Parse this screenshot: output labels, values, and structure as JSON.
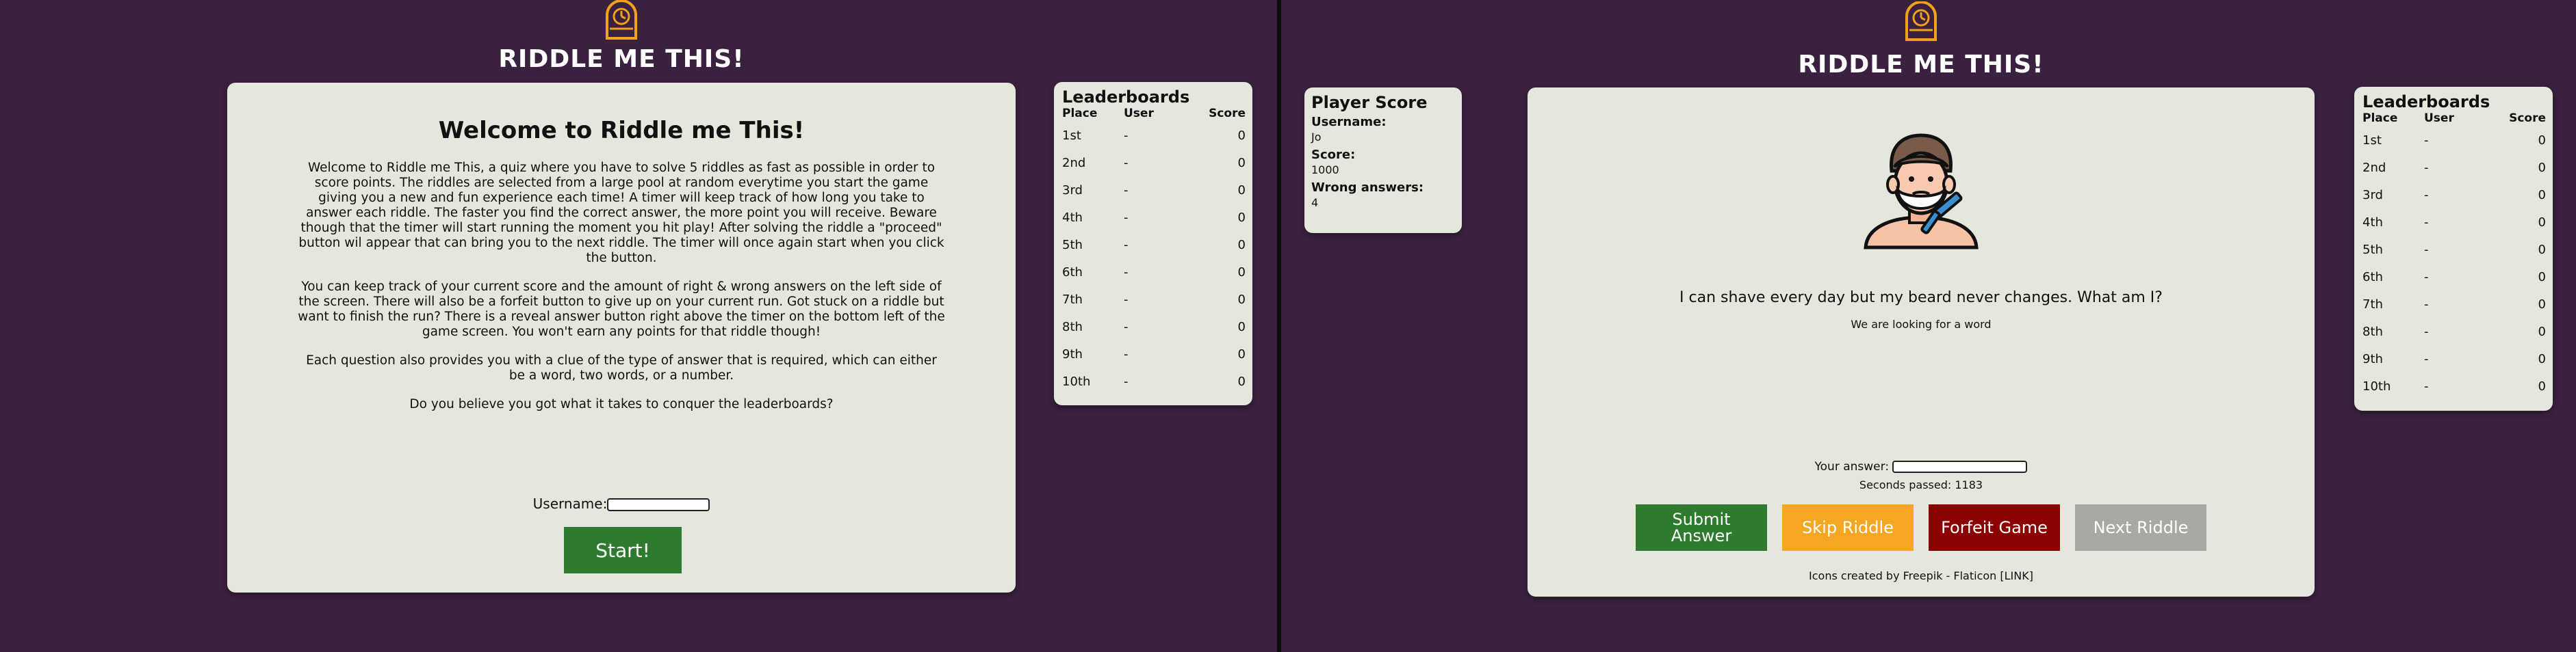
{
  "site": {
    "title": "RIDDLE ME THIS!"
  },
  "left_screen": {
    "welcome": {
      "heading": "Welcome to Riddle me This!",
      "paragraphs": [
        "Welcome to Riddle me This, a quiz where you have to solve 5 riddles as fast as possible in order to score points. The riddles are selected from a large pool at random everytime you start the game giving you a new and fun experience each time! A timer will keep track of how long you take to answer each riddle. The faster you find the correct answer, the more point you will receive. Beware though that the timer will start running the moment you hit play! After solving the riddle a \"proceed\" button wil appear that can bring you to the next riddle. The timer will once again start when you click the button.",
        "You can keep track of your current score and the amount of right & wrong answers on the left side of the screen. There will also be a forfeit button to give up on your current run. Got stuck on a riddle but want to finish the run? There is a reveal answer button right above the timer on the bottom left of the game screen. You won't earn any points for that riddle though!",
        "Each question also provides you with a clue of the type of answer that is required, which can either be a word, two words, or a number.",
        "Do you believe you got what it takes to conquer the leaderboards?"
      ],
      "username_label": "Username:",
      "username_value": "",
      "start_label": "Start!"
    }
  },
  "leaderboard": {
    "title": "Leaderboards",
    "headers": {
      "place": "Place",
      "user": "User",
      "score": "Score"
    },
    "rows": [
      {
        "place": "1st",
        "user": "-",
        "score": "0"
      },
      {
        "place": "2nd",
        "user": "-",
        "score": "0"
      },
      {
        "place": "3rd",
        "user": "-",
        "score": "0"
      },
      {
        "place": "4th",
        "user": "-",
        "score": "0"
      },
      {
        "place": "5th",
        "user": "-",
        "score": "0"
      },
      {
        "place": "6th",
        "user": "-",
        "score": "0"
      },
      {
        "place": "7th",
        "user": "-",
        "score": "0"
      },
      {
        "place": "8th",
        "user": "-",
        "score": "0"
      },
      {
        "place": "9th",
        "user": "-",
        "score": "0"
      },
      {
        "place": "10th",
        "user": "-",
        "score": "0"
      }
    ]
  },
  "right_screen": {
    "player_score": {
      "title": "Player Score",
      "username_label": "Username:",
      "username": "Jo",
      "score_label": "Score:",
      "score": "1000",
      "wrong_label": "Wrong answers:",
      "wrong": "4"
    },
    "riddle": {
      "text": "I can shave every day but my beard never changes. What am I?",
      "clue": "We are looking for a word",
      "image_icon": "bearded-man-shaving-icon"
    },
    "answer_label": "Your answer:",
    "answer_value": "",
    "timer_text": "Seconds passed: 1183",
    "buttons": {
      "submit": "Submit Answer",
      "skip": "Skip Riddle",
      "forfeit": "Forfeit Game",
      "next": "Next Riddle"
    },
    "credit": "Icons created by Freepik - Flaticon [LINK]"
  },
  "colors": {
    "background": "#3a213f",
    "panel": "#e4e8dc",
    "logo": "#f0a21a",
    "submit": "#2e7b2f",
    "skip": "#f5a623",
    "forfeit": "#8b0000",
    "next": "#a7a9a4"
  }
}
